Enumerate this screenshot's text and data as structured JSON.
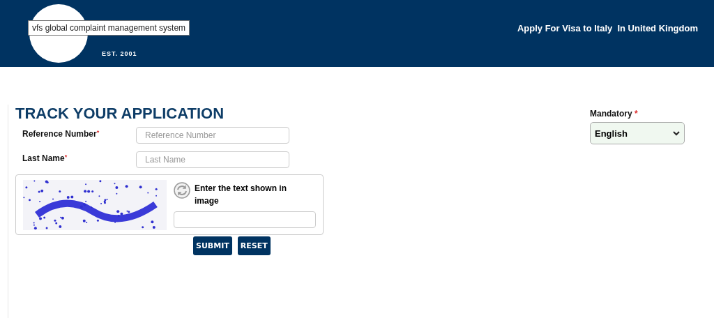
{
  "header": {
    "logo_tagline": "EST. 2001",
    "title": "Apply For Visa to Italy  In United Kingdom"
  },
  "tooltip": "vfs global complaint management system",
  "language": {
    "label": "Mandatory",
    "required_mark": "*",
    "value": "English"
  },
  "heading": "TRACK YOUR APPLICATION",
  "fields": [
    {
      "label": "Reference Number",
      "required_mark": "*",
      "placeholder": "Reference Number"
    },
    {
      "label": "Last Name",
      "required_mark": "*",
      "placeholder": "Last Name"
    }
  ],
  "captcha": {
    "prompt": "Enter the text shown in image"
  },
  "buttons": [
    "SUBMIT",
    "RESET"
  ]
}
